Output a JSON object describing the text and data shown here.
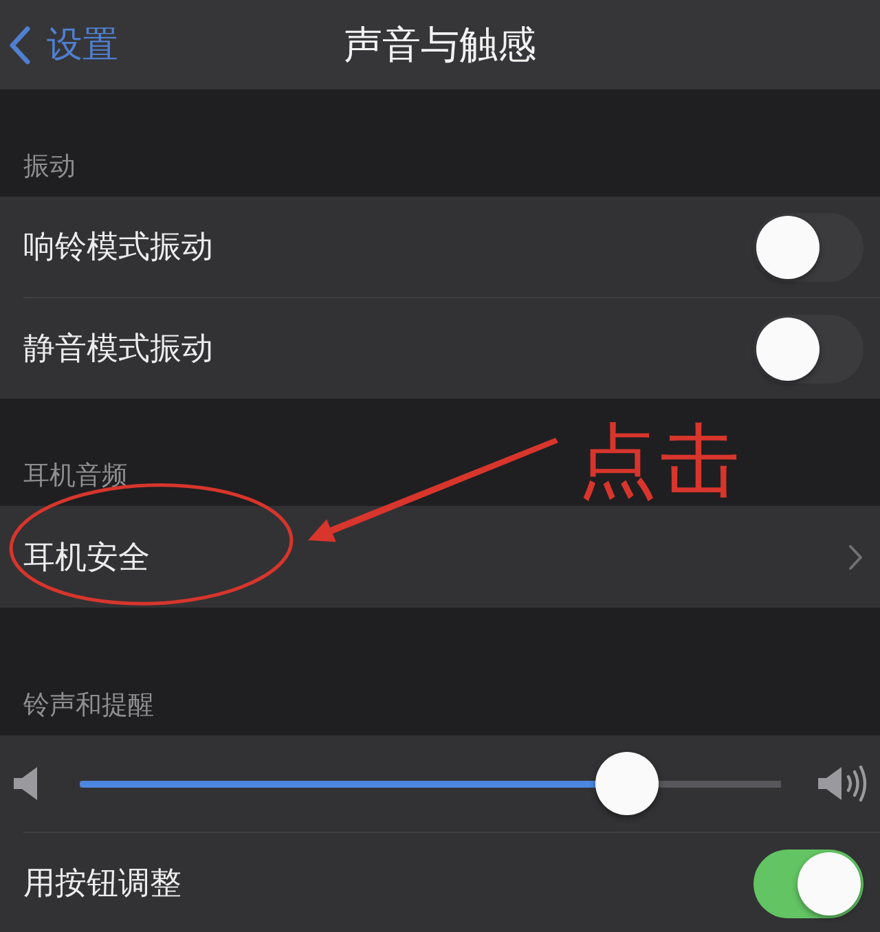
{
  "nav": {
    "back_label": "设置",
    "title": "声音与触感"
  },
  "sections": [
    {
      "header": "振动",
      "rows": [
        {
          "kind": "toggle",
          "label": "响铃模式振动",
          "on": false
        },
        {
          "kind": "toggle",
          "label": "静音模式振动",
          "on": false
        }
      ]
    },
    {
      "header": "耳机音频",
      "rows": [
        {
          "kind": "link",
          "label": "耳机安全"
        }
      ]
    },
    {
      "header": "铃声和提醒",
      "rows": [
        {
          "kind": "slider",
          "level": 0.78
        },
        {
          "kind": "toggle",
          "label": "用按钮调整",
          "on": true
        }
      ]
    }
  ],
  "annotation": {
    "label": "点击"
  }
}
